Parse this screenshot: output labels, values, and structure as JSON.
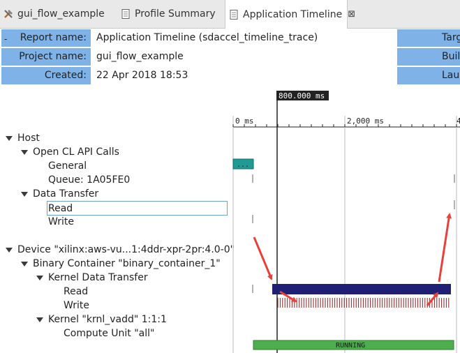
{
  "tabs": [
    {
      "label": "gui_flow_example",
      "icon": "tools-icon"
    },
    {
      "label": "Profile Summary",
      "icon": "document-icon"
    },
    {
      "label": "Application Timeline",
      "icon": "document-icon",
      "close": "⊠"
    }
  ],
  "header": {
    "collapse": "-",
    "report_name_label": "Report name:",
    "report_name": "Application Timeline (sdaccel_timeline_trace)",
    "project_name_label": "Project name:",
    "project_name": "gui_flow_example",
    "created_label": "Created:",
    "created": "22 Apr 2018 18:53",
    "right_labels": [
      "Targ",
      "Buil",
      "Lau"
    ]
  },
  "tree": {
    "host": "Host",
    "opencl": "Open CL API Calls",
    "general": "General",
    "queue": "Queue: 1A05FE0",
    "data_transfer": "Data Transfer",
    "read": "Read",
    "write": "Write",
    "device": "Device \"xilinx:aws-vu...1:4ddr-xpr-2pr:4.0-0\"",
    "binary": "Binary Container \"binary_container_1\"",
    "kdt": "Kernel Data Transfer",
    "kread": "Read",
    "kwrite": "Write",
    "kernel": "Kernel \"krnl_vadd\" 1:1:1",
    "cu": "Compute Unit \"all\""
  },
  "timeline": {
    "cursor_label": "800.000 ms",
    "tick_labels": [
      "0 ms",
      "2,000 ms",
      "4"
    ],
    "general_box": "...",
    "running": "RUNNING",
    "colors": {
      "general": "#1f9b94",
      "read_bar": "#1f1f75",
      "write_ticks": "#8a1f1f",
      "running": "#4cae4c",
      "arrow": "#e8403a",
      "header_blue": "#7fb2e6"
    }
  }
}
